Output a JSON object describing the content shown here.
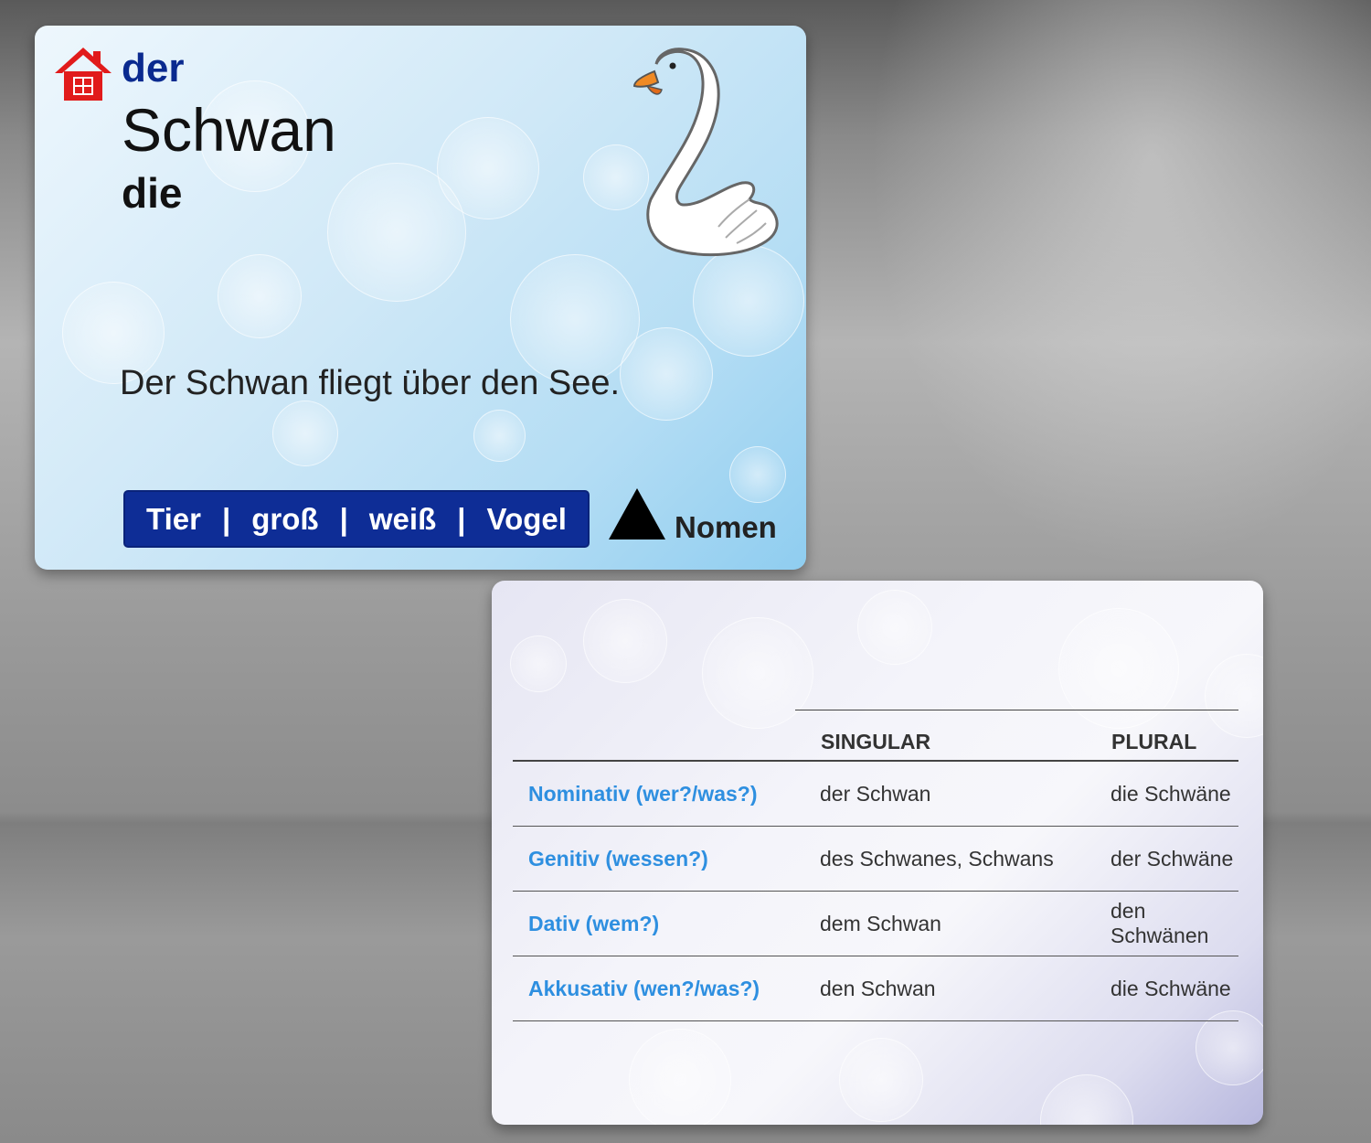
{
  "front": {
    "article": "der",
    "noun": "Schwan",
    "plural_article": "die",
    "example_sentence": "Der Schwan fliegt über den See.",
    "tags": [
      "Tier",
      "groß",
      "weiß",
      "Vogel"
    ],
    "separator": "|",
    "word_type": "Nomen",
    "colors": {
      "article": "#0a2a8f",
      "tag_bg": "#0e2d96",
      "house": "#e11b1b"
    }
  },
  "back": {
    "headers": [
      "SINGULAR",
      "PLURAL"
    ],
    "rows": [
      {
        "case": "Nominativ (wer?/was?)",
        "singular": "der Schwan",
        "plural": "die Schwäne"
      },
      {
        "case": "Genitiv (wessen?)",
        "singular": "des Schwanes, Schwans",
        "plural": "der Schwäne"
      },
      {
        "case": "Dativ (wem?)",
        "singular": "dem Schwan",
        "plural": "den Schwänen"
      },
      {
        "case": "Akkusativ (wen?/was?)",
        "singular": "den Schwan",
        "plural": "die Schwäne"
      }
    ],
    "colors": {
      "case_label": "#2e8fe0"
    }
  },
  "icons": [
    "house-icon",
    "swan-illustration",
    "triangle-icon"
  ]
}
